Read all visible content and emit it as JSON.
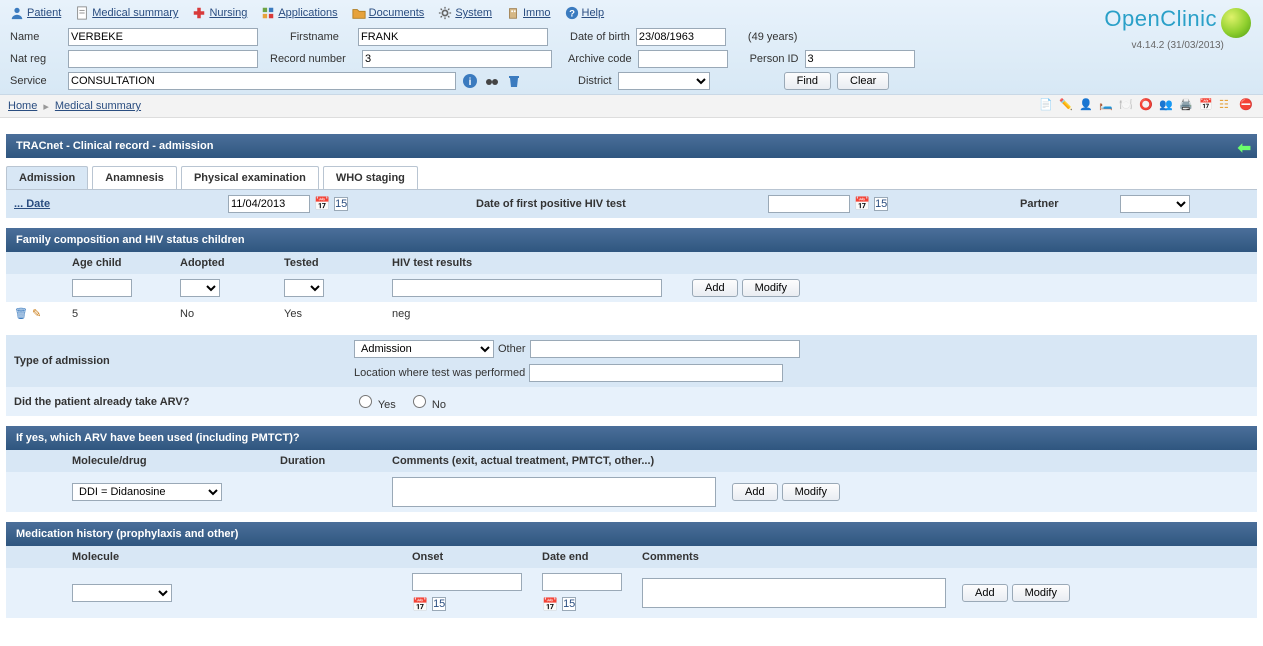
{
  "menu": {
    "patient": "Patient",
    "medical_summary": "Medical summary",
    "nursing": "Nursing",
    "applications": "Applications",
    "documents": "Documents",
    "system": "System",
    "immo": "Immo",
    "help": "Help"
  },
  "logo": {
    "text": "OpenClinic",
    "version": "v4.14.2 (31/03/2013)"
  },
  "patient_form": {
    "labels": {
      "name": "Name",
      "firstname": "Firstname",
      "dob": "Date of birth",
      "natreg": "Nat reg",
      "record_number": "Record number",
      "archive_code": "Archive code",
      "person_id": "Person ID",
      "service": "Service",
      "district": "District"
    },
    "values": {
      "name": "VERBEKE",
      "firstname": "FRANK",
      "dob": "23/08/1963",
      "age": "(49 years)",
      "natreg": "",
      "record_number": "3",
      "archive_code": "",
      "person_id": "3",
      "service": "CONSULTATION",
      "district": ""
    },
    "buttons": {
      "find": "Find",
      "clear": "Clear"
    }
  },
  "breadcrumb": {
    "home": "Home",
    "current": "Medical summary"
  },
  "section_title": "TRACnet - Clinical record - admission",
  "tabs": {
    "admission": "Admission",
    "anamnesis": "Anamnesis",
    "physical": "Physical examination",
    "who": "WHO staging"
  },
  "admission": {
    "date_label": "... Date",
    "date_value": "11/04/2013",
    "first_hiv_label": "Date of first positive HIV test",
    "first_hiv_value": "",
    "partner_label": "Partner",
    "partner_value": ""
  },
  "family": {
    "title": "Family composition and HIV status children",
    "headers": {
      "age": "Age child",
      "adopted": "Adopted",
      "tested": "Tested",
      "results": "HIV test results"
    },
    "buttons": {
      "add": "Add",
      "modify": "Modify"
    },
    "rows": [
      {
        "age": "5",
        "adopted": "No",
        "tested": "Yes",
        "results": "neg"
      }
    ]
  },
  "type_admission": {
    "label": "Type of admission",
    "select_value": "Admission",
    "other_label": "Other",
    "other_value": "",
    "location_label": "Location where test was performed",
    "location_value": ""
  },
  "arv_taken": {
    "label": "Did the patient already take ARV?",
    "yes": "Yes",
    "no": "No"
  },
  "arv_used": {
    "title": "If yes, which ARV have been used (including PMTCT)?",
    "headers": {
      "molecule": "Molecule/drug",
      "duration": "Duration",
      "comments": "Comments (exit, actual treatment, PMTCT, other...)"
    },
    "row": {
      "molecule": "DDI = Didanosine",
      "duration": "",
      "comments": ""
    },
    "buttons": {
      "add": "Add",
      "modify": "Modify"
    }
  },
  "med_history": {
    "title": "Medication history (prophylaxis and other)",
    "headers": {
      "molecule": "Molecule",
      "onset": "Onset",
      "date_end": "Date end",
      "comments": "Comments"
    },
    "row": {
      "molecule": "",
      "onset": "",
      "date_end": "",
      "comments": ""
    },
    "buttons": {
      "add": "Add",
      "modify": "Modify"
    }
  }
}
